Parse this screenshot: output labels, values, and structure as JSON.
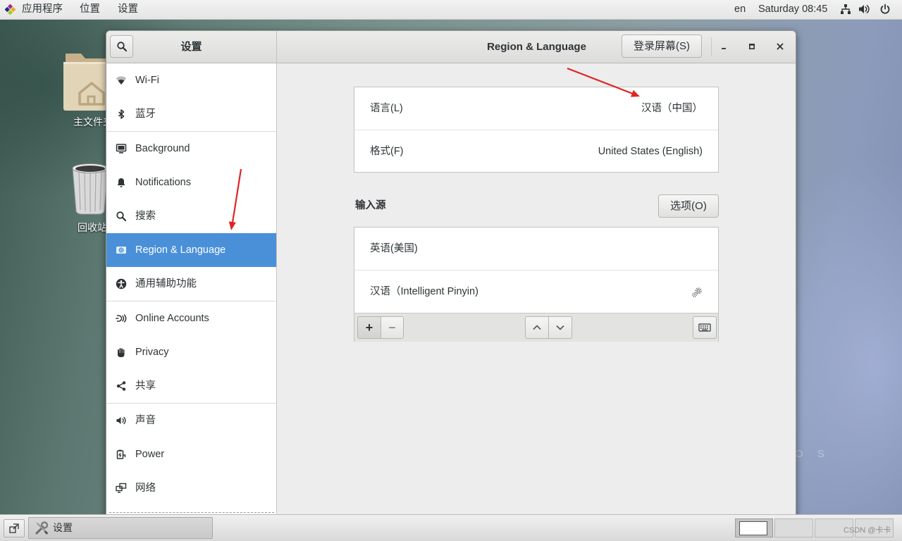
{
  "top_bar": {
    "apps_label": "应用程序",
    "places_label": "位置",
    "settings_label": "设置",
    "input_method": "en",
    "clock": "Saturday 08:45",
    "status_icons": [
      "network-icon",
      "volume-icon",
      "power-icon"
    ]
  },
  "desktop": {
    "icons": [
      {
        "label": "主文件夹",
        "icon": "home-folder-icon"
      },
      {
        "label": "回收站",
        "icon": "trash-icon"
      }
    ],
    "wallpaper_text": "O S"
  },
  "window": {
    "sidebar_title": "设置",
    "panel_title": "Region & Language",
    "login_screen_button": "登录屏幕(S)",
    "controls": [
      "minimize-icon",
      "maximize-icon",
      "close-icon"
    ],
    "selected_index": 5,
    "sidebar_items": [
      {
        "label": "Wi-Fi",
        "icon": "wifi-icon"
      },
      {
        "label": "蓝牙",
        "icon": "bluetooth-icon"
      },
      {
        "label": "Background",
        "icon": "background-icon"
      },
      {
        "label": "Notifications",
        "icon": "notifications-icon"
      },
      {
        "label": "搜索",
        "icon": "search-icon"
      },
      {
        "label": "Region & Language",
        "icon": "region-icon"
      },
      {
        "label": "通用辅助功能",
        "icon": "accessibility-icon"
      },
      {
        "label": "Online Accounts",
        "icon": "online-accounts-icon"
      },
      {
        "label": "Privacy",
        "icon": "privacy-icon"
      },
      {
        "label": "共享",
        "icon": "share-icon"
      },
      {
        "label": "声音",
        "icon": "sound-icon"
      },
      {
        "label": "Power",
        "icon": "power-icon"
      },
      {
        "label": "网络",
        "icon": "network-icon"
      }
    ]
  },
  "region": {
    "language": {
      "label": "语言(L)",
      "value": "汉语（中国）"
    },
    "formats": {
      "label": "格式(F)",
      "value": "United States (English)"
    },
    "input_sources_title": "输入源",
    "options_button": "选项(O)",
    "input_sources": [
      {
        "label": "英语(美国)",
        "has_settings": false
      },
      {
        "label": "汉语（Intelligent Pinyin)",
        "has_settings": true
      }
    ],
    "toolbar": {
      "add": "+",
      "remove": "−",
      "icons": [
        "move-up-icon",
        "move-down-icon",
        "keyboard-icon"
      ]
    }
  },
  "taskbar": {
    "task_label": "设置",
    "workspaces": 4,
    "active_workspace": 1,
    "watermark": "CSDN @卡卡"
  },
  "colors": {
    "accent": "#4a90d9",
    "annotation_arrow": "#e02424"
  }
}
